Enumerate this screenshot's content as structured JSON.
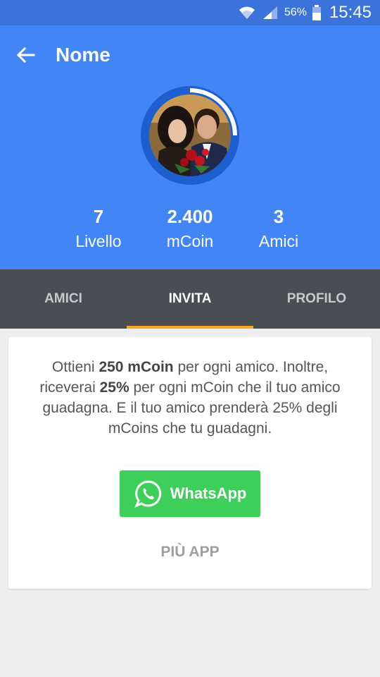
{
  "status_bar": {
    "battery_percent": "56%",
    "time": "15:45",
    "icons": [
      "wifi-icon",
      "signal-icon",
      "battery-icon"
    ]
  },
  "header": {
    "back_icon": "arrow-back-icon",
    "title": "Nome",
    "level_progress": 0.25
  },
  "stats": [
    {
      "value": "7",
      "label": "Livello"
    },
    {
      "value": "2.400",
      "label": "mCoin"
    },
    {
      "value": "3",
      "label": "Amici"
    }
  ],
  "tabs": [
    {
      "label": "AMICI",
      "active": false
    },
    {
      "label": "INVITA",
      "active": true
    },
    {
      "label": "PROFILO",
      "active": false
    }
  ],
  "invite": {
    "text_1": "Ottieni ",
    "bold_1": "250 mCoin",
    "text_2": " per ogni amico. Inoltre, riceverai ",
    "bold_2": "25%",
    "text_3": " per ogni mCoin che il tuo amico guadagna. E il tuo amico prenderà 25% degli mCoins che tu guadagni.",
    "whatsapp_label": "WhatsApp",
    "whatsapp_icon": "whatsapp-icon",
    "more_label": "PIÙ APP"
  },
  "colors": {
    "header_blue": "#4285f4",
    "status_blue": "#3b73db",
    "tab_bg": "#4a4e52",
    "tab_indicator": "#f5a623",
    "whatsapp_green": "#3ecf5b"
  }
}
